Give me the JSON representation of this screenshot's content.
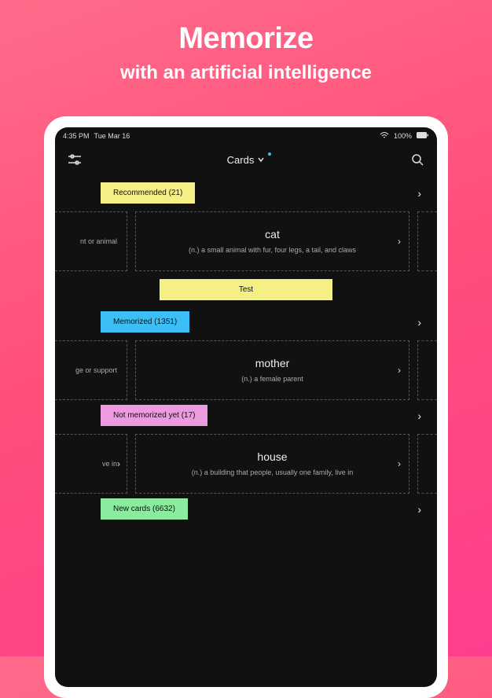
{
  "marketing": {
    "title": "Memorize",
    "subtitle": "with an artificial intelligence"
  },
  "status_bar": {
    "time": "4:35 PM",
    "date": "Tue Mar 16",
    "battery": "100%"
  },
  "header": {
    "title": "Cards"
  },
  "sections": [
    {
      "badge": "Recommended (21)",
      "badge_class": "badge-yellow",
      "partial_left": "nt or animal",
      "card": {
        "title": "cat",
        "def": "(n.) a small animal with fur, four legs, a tail, and claws"
      },
      "show_test": true,
      "test_label": "Test"
    },
    {
      "badge": "Memorized (1351)",
      "badge_class": "badge-blue",
      "partial_left": "ge or support",
      "card": {
        "title": "mother",
        "def": "(n.) a female parent"
      },
      "show_test": false
    },
    {
      "badge": "Not memorized yet (17)",
      "badge_class": "badge-pink",
      "partial_left": "ve in",
      "card": {
        "title": "house",
        "def": "(n.) a building that people, usually one family, live in"
      },
      "show_test": false,
      "partial_left_chevron": true
    },
    {
      "badge": "New cards (6632)",
      "badge_class": "badge-green"
    }
  ]
}
